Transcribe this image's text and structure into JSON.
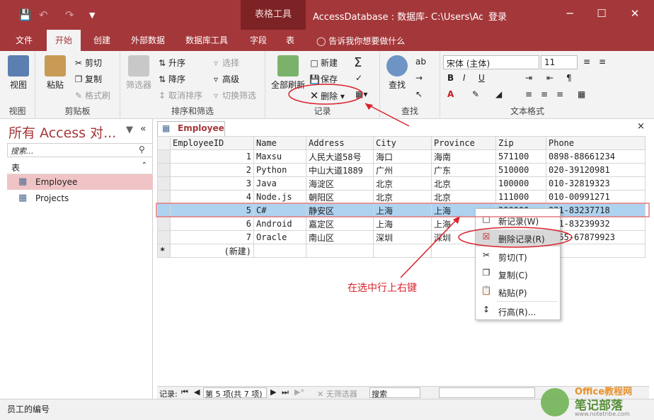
{
  "colors": {
    "accent": "#a4373a",
    "selection": "#aed3f0",
    "annotation": "#d9232d"
  },
  "titlebar": {
    "save_icon": "save-icon",
    "undo_icon": "undo-icon",
    "redo_icon": "redo-icon",
    "customize_icon": "customize-icon",
    "context_tab": "表格工具",
    "title": "AccessDatabase : 数据库- C:\\Users\\Ad...",
    "signin": "登录",
    "minimize": "─",
    "maximize": "☐",
    "close": "✕"
  },
  "tabs": [
    "文件",
    "开始",
    "创建",
    "外部数据",
    "数据库工具",
    "字段",
    "表"
  ],
  "tellme": "告诉我你想要做什么",
  "ribbon": {
    "views": {
      "view": "视图",
      "label": "视图"
    },
    "clipboard": {
      "paste": "粘贴",
      "cut": "剪切",
      "copy": "复制",
      "format_painter": "格式刷",
      "label": "剪贴板"
    },
    "sort": {
      "filter": "筛选器",
      "ascending": "升序",
      "descending": "降序",
      "remove_sort": "取消排序",
      "selection": "选择",
      "advanced": "高级",
      "toggle_filter": "切换筛选",
      "label": "排序和筛选"
    },
    "records": {
      "refresh": "全部刷新",
      "new": "新建",
      "save": "保存",
      "delete": "删除",
      "label": "记录"
    },
    "find": {
      "find": "查找",
      "label": "查找"
    },
    "text": {
      "font": "宋体 (主体)",
      "size": "11",
      "bold": "B",
      "italic": "I",
      "underline": "U",
      "label": "文本格式"
    }
  },
  "nav": {
    "title": "所有 Access 对...",
    "search_placeholder": "搜索...",
    "section": "表",
    "items": [
      "Employee",
      "Projects"
    ]
  },
  "doc": {
    "tab": "Employee",
    "close": "×"
  },
  "grid": {
    "columns": [
      "EmployeeID",
      "Name",
      "Address",
      "City",
      "Province",
      "Zip",
      "Phone"
    ],
    "rows": [
      [
        "1",
        "Maxsu",
        "人民大道58号",
        "海口",
        "海南",
        "571100",
        "0898-88661234"
      ],
      [
        "2",
        "Python",
        "中山大道1889",
        "广州",
        "广东",
        "510000",
        "020-39120981"
      ],
      [
        "3",
        "Java",
        "海淀区",
        "北京",
        "北京",
        "100000",
        "010-32819323"
      ],
      [
        "4",
        "Node.js",
        "朝阳区",
        "北京",
        "北京",
        "111000",
        "010-00991271"
      ],
      [
        "5",
        "C#",
        "静安区",
        "上海",
        "上海",
        "200000",
        "021-83237718"
      ],
      [
        "6",
        "Android",
        "嘉定区",
        "上海",
        "上海",
        "",
        "021-83239932"
      ],
      [
        "7",
        "Oracle",
        "南山区",
        "深圳",
        "深圳",
        "",
        "0755-67879923"
      ]
    ],
    "new_row": "(新建)",
    "new_marker": "*"
  },
  "context_menu": {
    "items": [
      "新记录(W)",
      "删除记录(R)",
      "剪切(T)",
      "复制(C)",
      "粘贴(P)",
      "行高(R)..."
    ]
  },
  "record_nav": {
    "label": "记录:",
    "position": "第 5 项(共 7 项)",
    "no_filter": "无筛选器",
    "search": "搜索"
  },
  "status": {
    "text": "员工的编号"
  },
  "annotation": "在选中行上右键",
  "watermark": {
    "line1": "Office教程网",
    "line2": "笔记部落",
    "line3": "www.notetribe.com"
  }
}
